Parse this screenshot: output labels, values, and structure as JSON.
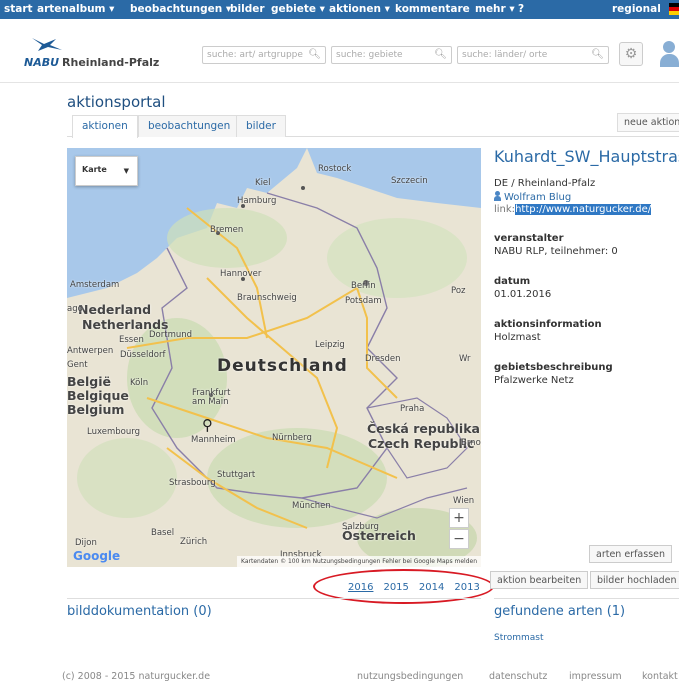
{
  "topnav": {
    "items": [
      "start",
      "artenalbum ▾",
      "beobachtungen ▾",
      "bilder",
      "gebiete ▾",
      "aktionen ▾",
      "kommentare",
      "mehr ▾",
      "?",
      "regional"
    ]
  },
  "header": {
    "logo": "NABU",
    "region": "Rheinland-Pfalz",
    "search_species_placeholder": "suche: art/ artgruppe",
    "search_areas_placeholder": "suche: gebiete",
    "search_places_placeholder": "suche: länder/ orte"
  },
  "page": {
    "title": "aktionsportal",
    "tabs": [
      "aktionen",
      "beobachtungen",
      "bilder"
    ],
    "new_action_label": "neue aktion"
  },
  "map": {
    "type_select": "Karte",
    "labels": {
      "deutschland": "Deutschland",
      "nederland": "Nederland",
      "netherlands": "Netherlands",
      "belgie": "België",
      "belgique": "Belgique",
      "belgium": "Belgium",
      "luxembourg": "Luxembourg",
      "ceska": "Česká republika",
      "czech": "Czech Republic",
      "osterreich": "Österreich",
      "kiel": "Kiel",
      "rostock": "Rostock",
      "hamburg": "Hamburg",
      "szczecin": "Szczecin",
      "bremen": "Bremen",
      "amsterdam": "Amsterdam",
      "hannover": "Hannover",
      "berlin": "Berlin",
      "potsdam": "Potsdam",
      "braunschweig": "Braunschweig",
      "dortmund": "Dortmund",
      "essen": "Essen",
      "dusseldorf": "Düsseldorf",
      "antwerpen": "Antwerpen",
      "gent": "Gent",
      "leipzig": "Leipzig",
      "dresden": "Dresden",
      "koln": "Köln",
      "frankfurt": "Frankfurt am Main",
      "praha": "Praha",
      "mannheim": "Mannheim",
      "nurnberg": "Nürnberg",
      "stuttgart": "Stuttgart",
      "strasbourg": "Strasbourg",
      "munchen": "München",
      "salzburg": "Salzburg",
      "wien": "Wien",
      "brno": "Brno",
      "basel": "Basel",
      "zurich": "Zürich",
      "innsbruck": "Innsbruck",
      "dijon": "Dijon",
      "poz": "Poz",
      "wr": "Wr",
      "ago": "ago"
    },
    "zoom_in": "+",
    "zoom_out": "−",
    "google": "Google",
    "attribution": "Kartendaten © 100 km  Nutzungsbedingungen  Fehler bei Google Maps melden"
  },
  "years": [
    "2016",
    "2015",
    "2014",
    "2013"
  ],
  "bilddokumentation": "bilddokumentation (0)",
  "action": {
    "title": "Kuhardt_SW_Hauptstrase_",
    "region": "DE / Rheinland-Pfalz",
    "person": "Wolfram Blug",
    "link_label": "link:",
    "link_url": "http://www.naturgucker.de/",
    "organizer_label": "veranstalter",
    "organizer_value": "NABU RLP, teilnehmer: 0",
    "date_label": "datum",
    "date_value": "01.01.2016",
    "info_label": "aktionsinformation",
    "info_value": "Holzmast",
    "area_label": "gebietsbeschreibung",
    "area_value": "Pfalzwerke Netz",
    "btn_species": "arten erfassen",
    "btn_edit": "aktion bearbeiten",
    "btn_images": "bilder hochladen",
    "found_species": "gefundene arten (1)",
    "species_item": "Strommast"
  },
  "footer": {
    "copyright": "(c) 2008 - 2015 naturgucker.de",
    "links": [
      "nutzungsbedingungen",
      "datenschutz",
      "impressum",
      "kontakt"
    ]
  }
}
